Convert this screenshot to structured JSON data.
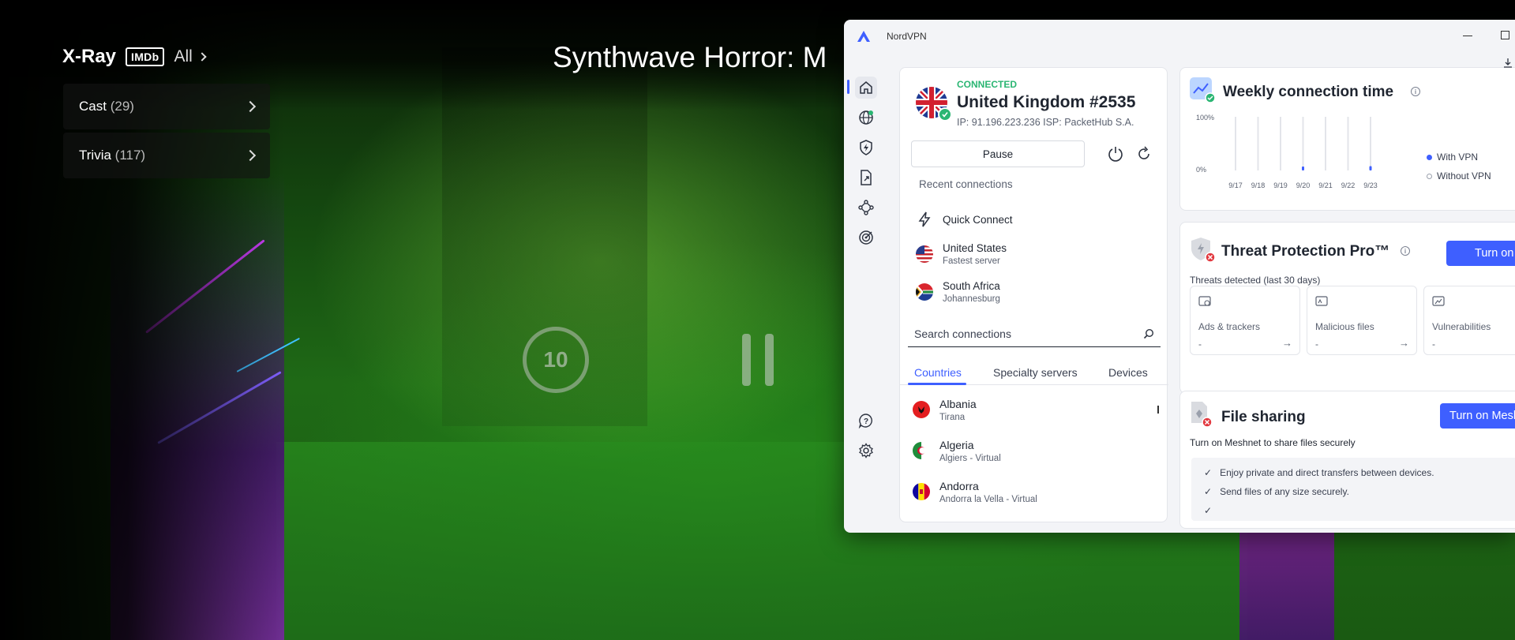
{
  "video": {
    "title": "Synthwave Horror: M",
    "rewind_seconds": "10"
  },
  "xray": {
    "title": "X-Ray",
    "badge": "IMDb",
    "all_label": "All",
    "items": [
      {
        "label": "Cast",
        "count": "(29)"
      },
      {
        "label": "Trivia",
        "count": "(117)"
      }
    ]
  },
  "vpn": {
    "app_name": "NordVPN",
    "accent_color": "#3e5fff",
    "connected_color": "#2bb673",
    "sidebar_icons": [
      "home-icon",
      "globe-icon",
      "shield-bolt-icon",
      "file-share-icon",
      "meshnet-icon",
      "target-icon",
      "help-icon",
      "gear-icon"
    ],
    "connection": {
      "status": "CONNECTED",
      "server": "United Kingdom #2535",
      "meta": "IP: 91.196.223.236    ISP: PacketHub S.A."
    },
    "pause_label": "Pause",
    "recent_title": "Recent connections",
    "quick_connect": "Quick Connect",
    "recent": [
      {
        "name": "United States",
        "sub": "Fastest server"
      },
      {
        "name": "South Africa",
        "sub": "Johannesburg"
      }
    ],
    "search_placeholder": "Search connections",
    "tabs": [
      "Countries",
      "Specialty servers",
      "Devices"
    ],
    "countries": [
      {
        "name": "Albania",
        "sub": "Tirana"
      },
      {
        "name": "Algeria",
        "sub": "Algiers - Virtual"
      },
      {
        "name": "Andorra",
        "sub": "Andorra la Vella - Virtual"
      }
    ],
    "weekly": {
      "title": "Weekly connection time",
      "y_top": "100%",
      "y_bottom": "0%",
      "days": [
        "9/17",
        "9/18",
        "9/19",
        "9/20",
        "9/21",
        "9/22",
        "9/23"
      ],
      "with_vpn_fraction": [
        0,
        0,
        0,
        0.05,
        0,
        0,
        0.08
      ],
      "legend_with": "With VPN",
      "legend_without": "Without VPN"
    },
    "threat": {
      "title": "Threat Protection Pro™",
      "button": "Turn on",
      "subtitle": "Threats detected (last 30 days)",
      "tiles": [
        {
          "label": "Ads & trackers",
          "value": "-"
        },
        {
          "label": "Malicious files",
          "value": "-"
        },
        {
          "label": "Vulnerabilities",
          "value": "-"
        }
      ]
    },
    "file_sharing": {
      "title": "File sharing",
      "button": "Turn on Meshnet",
      "subtitle": "Turn on Meshnet to share files securely",
      "features": [
        "Enjoy private and direct transfers between devices.",
        "Send files of any size securely."
      ]
    }
  }
}
